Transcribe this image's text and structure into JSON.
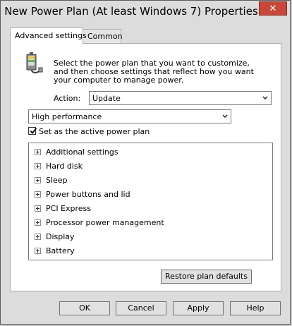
{
  "window": {
    "title": "New Power Plan (At least Windows 7) Properties",
    "close_glyph": "✕"
  },
  "tabs": [
    {
      "label": "Advanced settings",
      "active": true
    },
    {
      "label": "Common",
      "active": false
    }
  ],
  "panel": {
    "description": "Select the power plan that you want to customize, and then choose settings that reflect how you want your computer to manage power.",
    "icon": "power-plan-icon",
    "action_label": "Action:",
    "action_value": "Update",
    "plan_value": "High performance",
    "active_checkbox": {
      "label": "Set as the active power plan",
      "checked": true
    },
    "tree_items": [
      "Additional settings",
      "Hard disk",
      "Sleep",
      "Power buttons and lid",
      "PCI Express",
      "Processor power management",
      "Display",
      "Battery"
    ],
    "restore_label": "Restore plan defaults"
  },
  "footer": {
    "ok_label": "OK",
    "cancel_label": "Cancel",
    "apply_label": "Apply",
    "help_label": "Help"
  }
}
